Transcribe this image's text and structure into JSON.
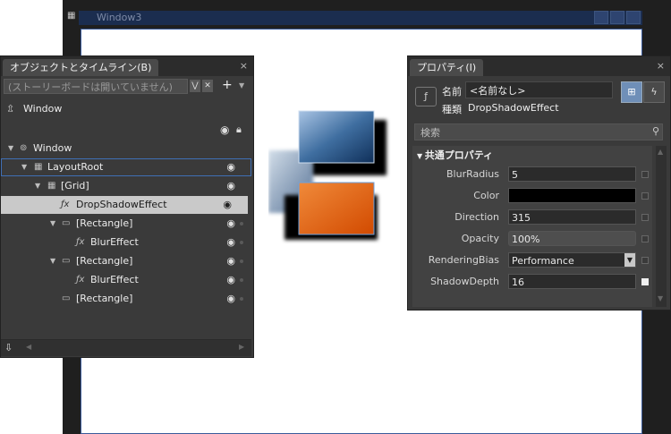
{
  "designer": {
    "window_title": "Window3"
  },
  "objects_panel": {
    "title": "オブジェクトとタイムライン(B)",
    "close": "×",
    "storyboard_placeholder": "(ストーリーボードは開いていません)",
    "add": "+",
    "scope": "Window",
    "tree": [
      {
        "label": "Window"
      },
      {
        "label": "LayoutRoot"
      },
      {
        "label": "[Grid]"
      },
      {
        "label": "DropShadowEffect"
      },
      {
        "label": "[Rectangle]"
      },
      {
        "label": "BlurEffect"
      },
      {
        "label": "[Rectangle]"
      },
      {
        "label": "BlurEffect"
      },
      {
        "label": "[Rectangle]"
      }
    ]
  },
  "properties_panel": {
    "title": "プロパティ(I)",
    "close": "×",
    "name_label": "名前",
    "name_value": "<名前なし>",
    "type_label": "種類",
    "type_value": "DropShadowEffect",
    "search_placeholder": "検索",
    "category": "共通プロパティ",
    "properties": [
      {
        "label": "BlurRadius",
        "value": "5"
      },
      {
        "label": "Color",
        "value": ""
      },
      {
        "label": "Direction",
        "value": "315"
      },
      {
        "label": "Opacity",
        "value": "100%"
      },
      {
        "label": "RenderingBias",
        "value": "Performance"
      },
      {
        "label": "ShadowDepth",
        "value": "16"
      }
    ],
    "color_value_hex": "#000000"
  },
  "colors": {
    "accent_blue": "#1b3a6b",
    "orange": "#e8650a"
  }
}
